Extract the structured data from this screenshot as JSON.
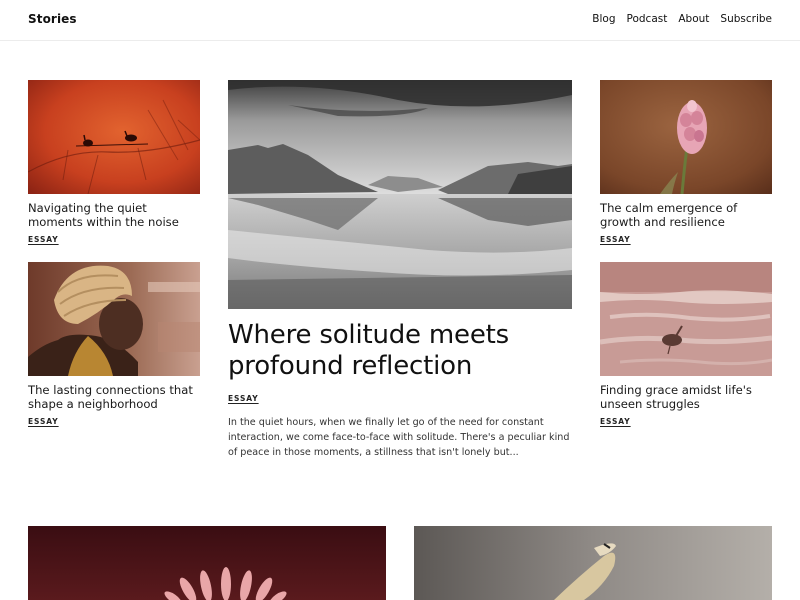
{
  "header": {
    "brand": "Stories",
    "nav": [
      "Blog",
      "Podcast",
      "About",
      "Subscribe"
    ]
  },
  "cards": [
    {
      "title": "Navigating the quiet moments within the noise",
      "tag": "ESSAY",
      "image": "birds-on-branch-red"
    },
    {
      "title": "The lasting connections that shape a neighborhood",
      "tag": "ESSAY",
      "image": "woman-portrait"
    },
    {
      "title": "The calm emergence of growth and resilience",
      "tag": "ESSAY",
      "image": "pink-flower-bud"
    },
    {
      "title": "Finding grace amidst life's unseen struggles",
      "tag": "ESSAY",
      "image": "bird-on-snow"
    }
  ],
  "feature": {
    "title": "Where solitude meets profound reflection",
    "tag": "ESSAY",
    "excerpt": "In the quiet hours, when we finally let go of the need for constant interaction, we come face-to-face with solitude. There's a peculiar kind of peace in those moments, a stillness that isn't lonely but...",
    "image": "mountain-lake-bw"
  },
  "bottom_images": [
    "pink-daisy",
    "seagull-flight"
  ],
  "colors": {
    "text": "#1a1a1a",
    "border": "#ececec",
    "background": "#ffffff"
  }
}
